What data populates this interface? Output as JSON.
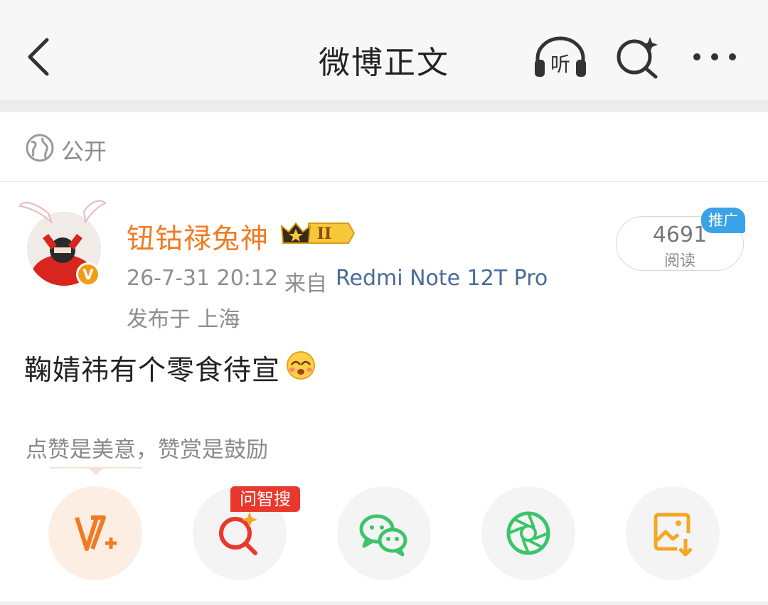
{
  "header": {
    "title": "微博正文",
    "listen_label": "听"
  },
  "visibility": {
    "label": "公开",
    "icon": "globe-icon"
  },
  "post": {
    "author": {
      "name": "钮钴禄兔神",
      "rank_badge": "II"
    },
    "time": "26-7-31 20:12",
    "source_prefix": "来自",
    "source": "Redmi Note 12T Pro",
    "location": "发布于 上海",
    "reads": {
      "count": "4691",
      "label": "阅读"
    },
    "promo_tag": "推广",
    "text": "鞠婧祎有个零食待宣"
  },
  "reward_hint": "点赞是美意，赞赏是鼓励",
  "actions": [
    {
      "icon": "reward-v-plus-icon",
      "accent": "#f07b22"
    },
    {
      "icon": "ai-search-icon",
      "badge": "问智搜",
      "accent": "#e8392c"
    },
    {
      "icon": "wechat-icon",
      "accent": "#3cc46b"
    },
    {
      "icon": "moments-icon",
      "accent": "#3cc46b"
    },
    {
      "icon": "save-image-icon",
      "accent": "#f5a623"
    }
  ],
  "colors": {
    "username": "#f07b22",
    "source_link": "#4a6a98",
    "promo": "#3aa2e6",
    "badge_red": "#e8392c"
  }
}
